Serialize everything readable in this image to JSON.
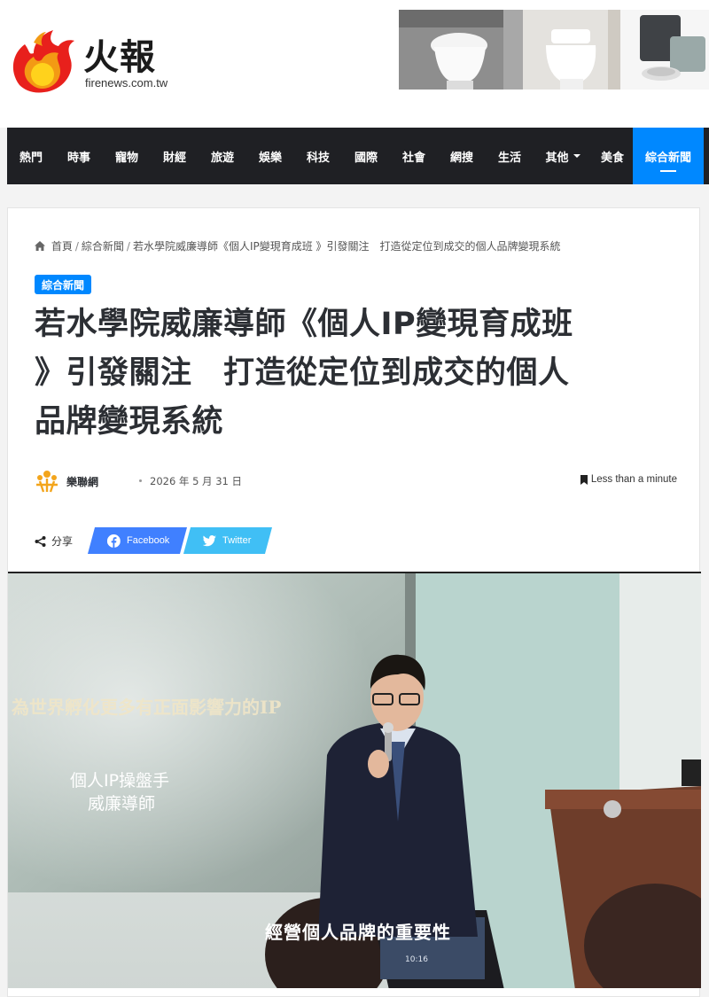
{
  "site": {
    "logo_text": "火報",
    "domain": "firenews.com.tw",
    "logo_icon": "flame-logo-icon"
  },
  "nav": {
    "items": [
      {
        "label": "熱門"
      },
      {
        "label": "時事"
      },
      {
        "label": "寵物"
      },
      {
        "label": "財經"
      },
      {
        "label": "旅遊"
      },
      {
        "label": "娛樂"
      },
      {
        "label": "科技"
      },
      {
        "label": "國際"
      },
      {
        "label": "社會"
      },
      {
        "label": "網搜"
      },
      {
        "label": "生活"
      },
      {
        "label": "其他"
      },
      {
        "label": "美食"
      },
      {
        "label": "綜合新聞"
      }
    ],
    "active": "綜合新聞",
    "colors": {
      "bar": "#1f2024",
      "active": "#0088ff"
    }
  },
  "breadcrumb": {
    "home": "首頁",
    "category": "綜合新聞",
    "current": "若水學院威廉導師《個人IP變現育成班 》引發關注　打造從定位到成交的個人品牌變現系統"
  },
  "article": {
    "category_badge": "綜合新聞",
    "title_lines": [
      "若水學院威廉導師《個人IP變現育成班",
      "》引發關注　打造從定位到成交的個人",
      "品牌變現系統"
    ],
    "author": "樂聯網",
    "date": "2026 年 5 月 31 日",
    "read_time": "Less than a minute"
  },
  "share": {
    "label": "分享",
    "facebook": "Facebook",
    "twitter": "Twitter",
    "colors": {
      "facebook": "#4080ff",
      "twitter": "#40bff5"
    }
  },
  "hero": {
    "slide_caption": "為世界孵化更多有正面影響力的IP",
    "slide_role": "個人IP操盤手",
    "slide_name": "威廉導師",
    "subtitle": "經營個人品牌的重要性",
    "laptop_time": "10:16"
  }
}
